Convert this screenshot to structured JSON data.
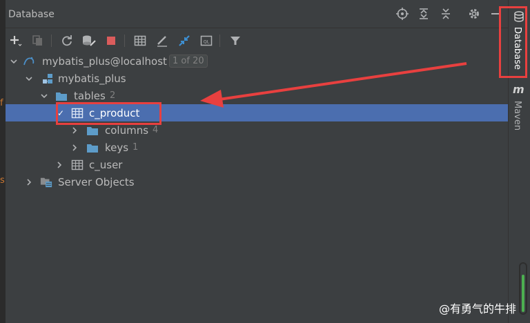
{
  "panel": {
    "title": "Database"
  },
  "tree": {
    "datasource": {
      "label": "mybatis_plus@localhost",
      "badge": "1 of 20"
    },
    "schema": {
      "label": "mybatis_plus"
    },
    "tables_folder": {
      "label": "tables",
      "count": "2"
    },
    "table1": {
      "label": "c_product",
      "check": "✓"
    },
    "columns": {
      "label": "columns",
      "count": "4"
    },
    "keys": {
      "label": "keys",
      "count": "1"
    },
    "table2": {
      "label": "c_user"
    },
    "server_objects": {
      "label": "Server Objects"
    }
  },
  "sidebar": {
    "database_tab": "Database",
    "maven_letter": "m",
    "maven_tab": "Maven"
  },
  "watermark": "@有勇气的牛排",
  "colors": {
    "selection": "#4b6eaf",
    "annotation": "#e8403f",
    "folder": "#5d9cc9",
    "bg": "#3c3f41"
  }
}
